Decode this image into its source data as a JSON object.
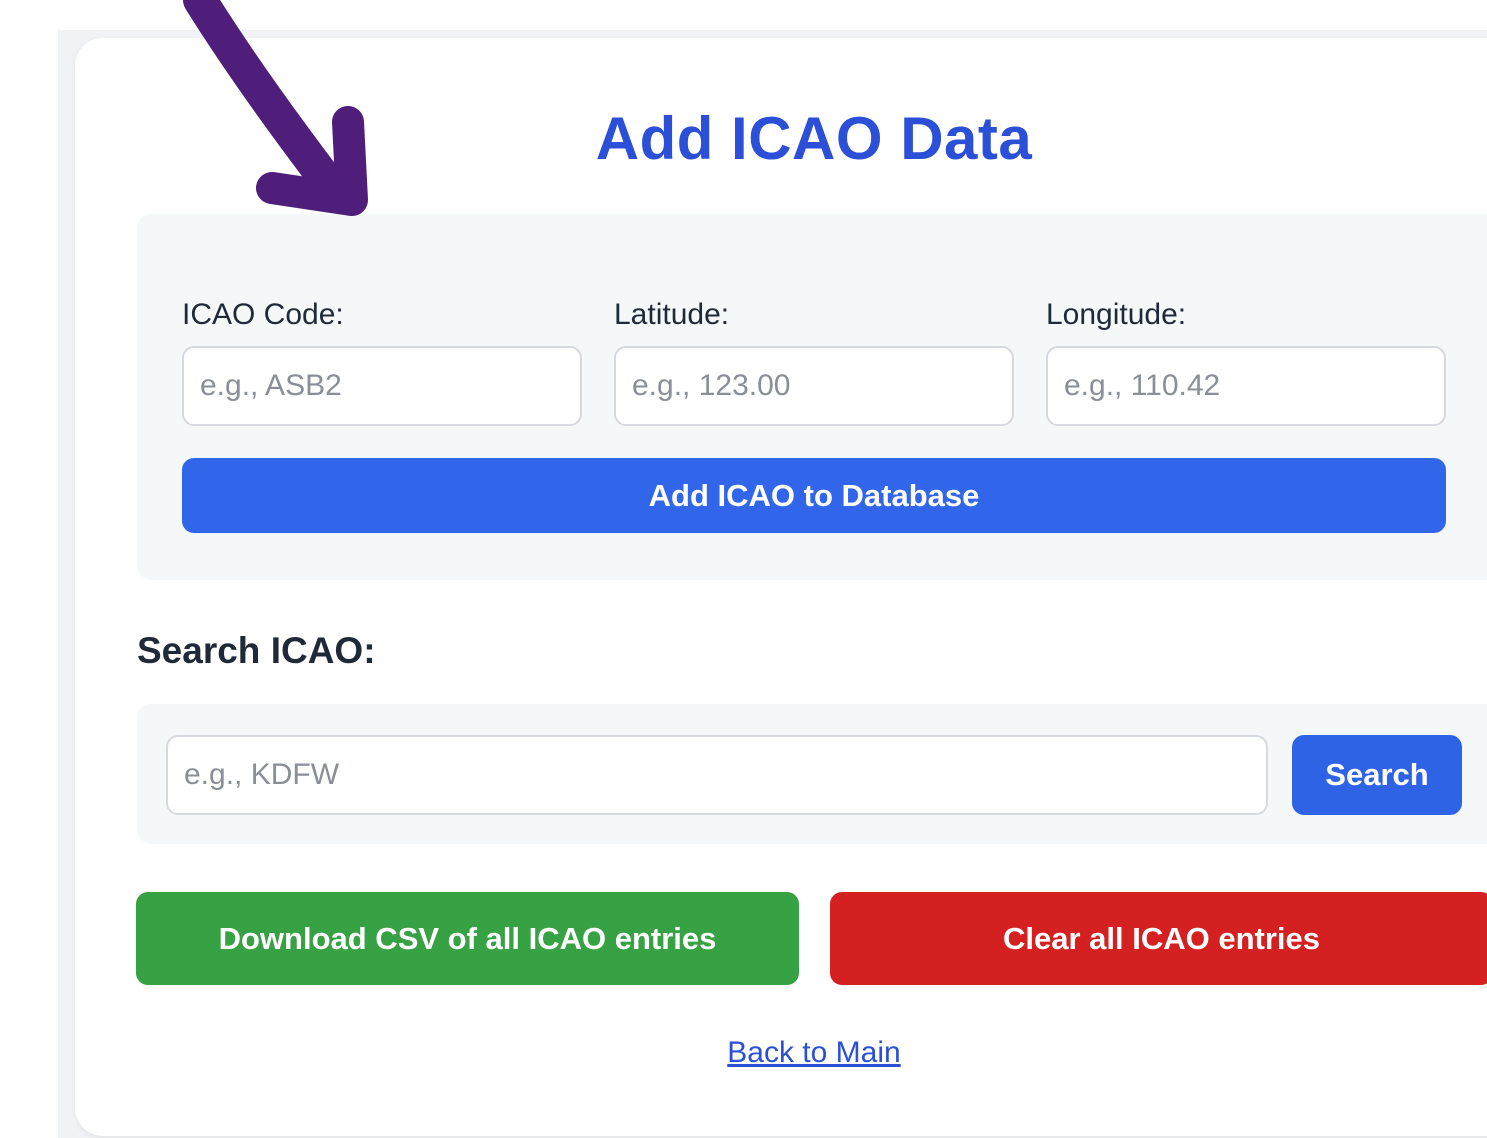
{
  "page": {
    "title": "Add ICAO Data"
  },
  "add_form": {
    "icao_label": "ICAO Code:",
    "icao_placeholder": "e.g., ASB2",
    "icao_value": "",
    "latitude_label": "Latitude:",
    "latitude_placeholder": "e.g., 123.00",
    "latitude_value": "",
    "longitude_label": "Longitude:",
    "longitude_placeholder": "e.g., 110.42",
    "longitude_value": "",
    "submit_label": "Add ICAO to Database"
  },
  "search": {
    "heading": "Search ICAO:",
    "placeholder": "e.g., KDFW",
    "value": "",
    "button_label": "Search"
  },
  "actions": {
    "download_label": "Download CSV of all ICAO entries",
    "clear_label": "Clear all ICAO entries"
  },
  "footer": {
    "back_link": "Back to Main"
  },
  "colors": {
    "title": "#2b4fd6",
    "primary": "#3266ea",
    "download": "#37a243",
    "clear": "#d42020",
    "annotation_arrow": "#4f1d7a"
  },
  "annotation": {
    "icon": "arrow-annotation-icon"
  }
}
